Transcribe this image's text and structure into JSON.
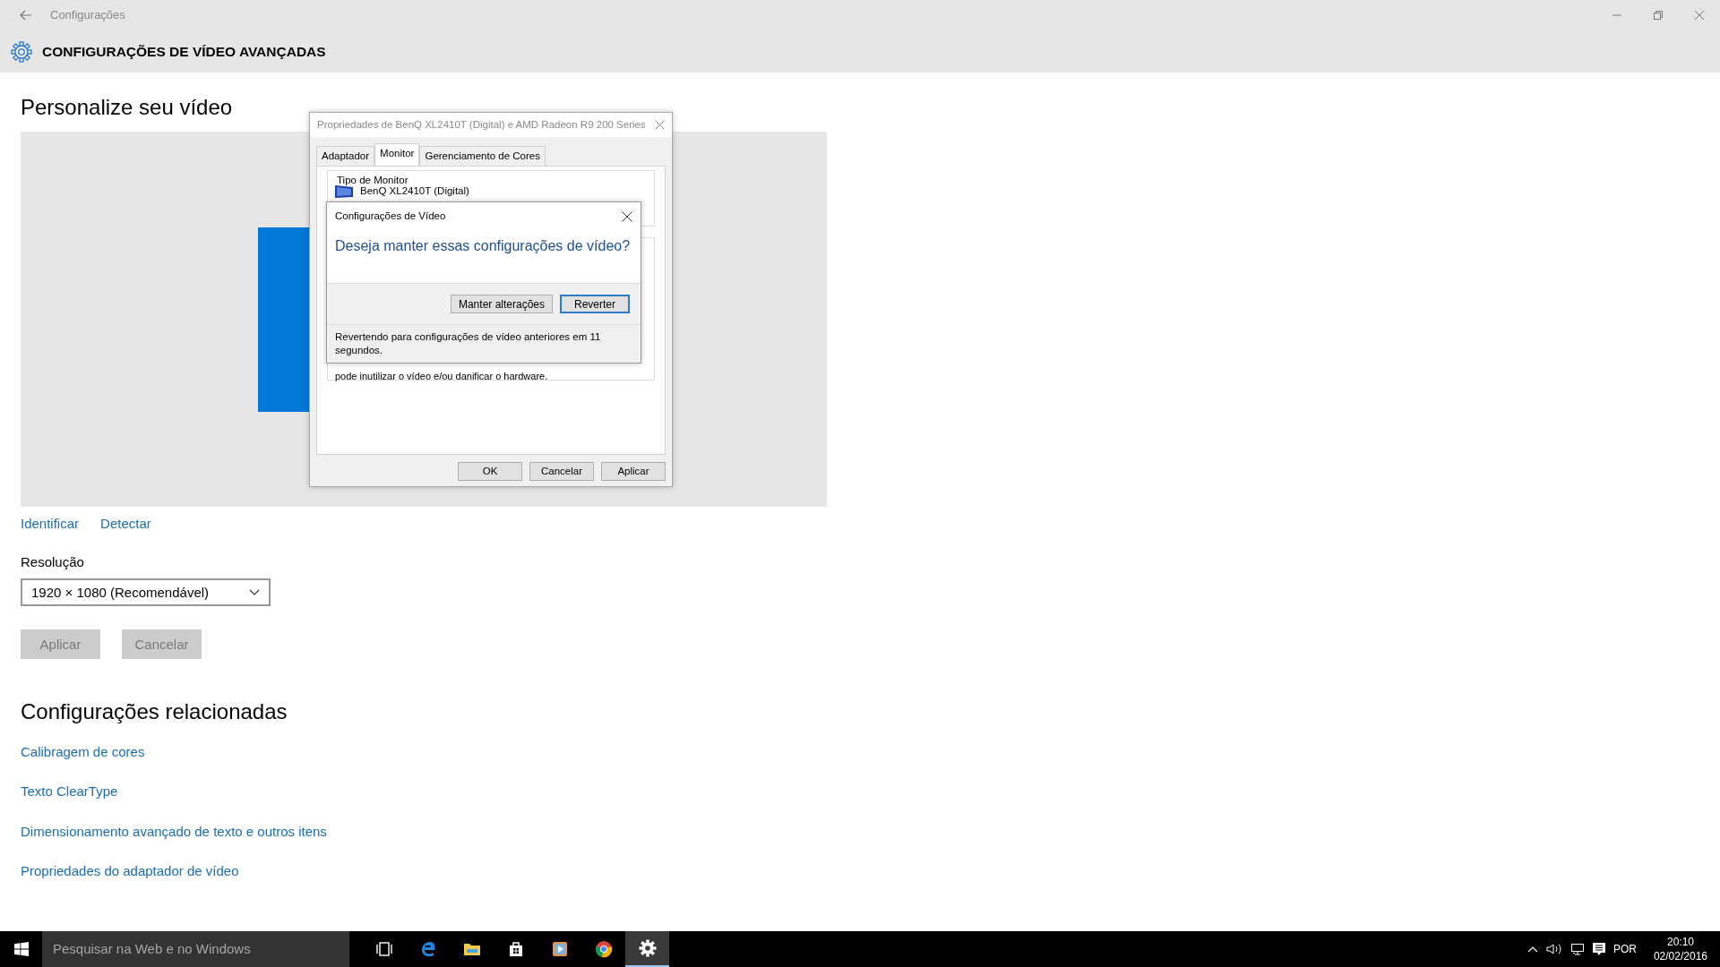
{
  "window": {
    "title": "Configurações",
    "page_title": "CONFIGURAÇÕES DE VÍDEO AVANÇADAS"
  },
  "main": {
    "heading": "Personalize seu vídeo",
    "display_links": [
      "Identificar",
      "Detectar"
    ],
    "resolution": {
      "label": "Resolução",
      "value": "1920 × 1080 (Recomendável)"
    },
    "buttons": [
      {
        "label": "Aplicar",
        "disabled": true
      },
      {
        "label": "Cancelar",
        "disabled": true
      }
    ],
    "related": {
      "heading": "Configurações relacionadas",
      "links": [
        "Calibragem de cores",
        "Texto ClearType",
        "Dimensionamento avançado de texto e outros itens",
        "Propriedades do adaptador de vídeo"
      ]
    }
  },
  "properties_dialog": {
    "title": "Propriedades de BenQ XL2410T (Digital) e AMD Radeon R9 200 Series",
    "tabs": [
      {
        "label": "Adaptador",
        "selected": false
      },
      {
        "label": "Monitor",
        "selected": true
      },
      {
        "label": "Gerenciamento de Cores",
        "selected": false
      }
    ],
    "monitor_type": {
      "legend": "Tipo de Monitor",
      "name": "BenQ XL2410T (Digital)"
    },
    "warning_text": "pode inutilizar o vídeo e/ou danificar o hardware.",
    "buttons": [
      "OK",
      "Cancelar",
      "Aplicar"
    ]
  },
  "confirm_dialog": {
    "title": "Configurações de Vídeo",
    "question": "Deseja manter essas configurações de vídeo?",
    "buttons": [
      {
        "label": "Manter alterações",
        "default": false
      },
      {
        "label": "Reverter",
        "default": true
      }
    ],
    "countdown": "Revertendo para configurações de vídeo anteriores em 11 segundos."
  },
  "taskbar": {
    "search_placeholder": "Pesquisar na Web e no Windows",
    "apps": [
      {
        "kind": "taskview",
        "active": false
      },
      {
        "kind": "edge",
        "active": false
      },
      {
        "kind": "explorer",
        "active": false
      },
      {
        "kind": "store",
        "active": false
      },
      {
        "kind": "media",
        "active": false
      },
      {
        "kind": "chrome",
        "active": false
      },
      {
        "kind": "settings",
        "active": true
      }
    ],
    "tray": {
      "language": "POR",
      "time": "20:10",
      "date": "02/02/2016"
    }
  }
}
